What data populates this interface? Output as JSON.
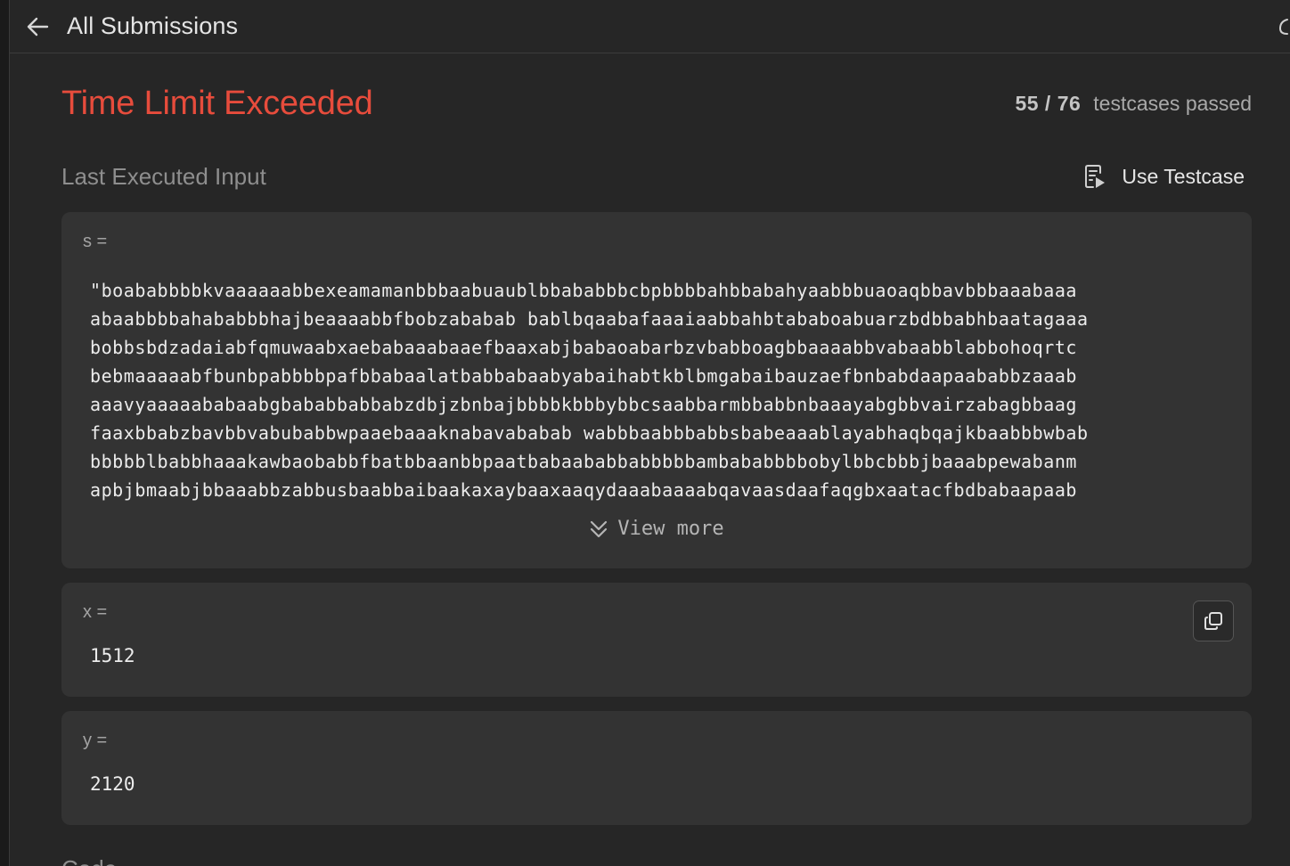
{
  "header": {
    "back_label": "All Submissions"
  },
  "result": {
    "status": "Time Limit Exceeded",
    "passed": "55 / 76",
    "passed_suffix": "testcases passed"
  },
  "last_input": {
    "label": "Last Executed Input",
    "use_testcase_label": "Use Testcase"
  },
  "inputs": {
    "s": {
      "label": "s =",
      "lines": [
        "\"boababbbbkvaaaaaabbexeamamanbbbaabuaublbbababbbcbpbbbbahbbabahyaabbbuaoaqbbavbbbaaabaaa",
        "abaabbbbahababbbhajbeaaaabbfbobzababab bablbqaabafaaaiaabbahbtababoabuarzbdbbabhbaatagaaa",
        "bobbsbdzadaiabfqmuwaabxaebabaaabaaefbaaxabjbabaoabarbzvbabboagbbaaaabbvabaabblabbohoqrtc",
        "bebmaaaaabfbunbpabbbbpafbbabaalatbabbabaabyabaihabtkblbmgabaibauzaefbnbabdaapaababbzaaab",
        "aaavyaaaaababaabgbababbabbabzdbjzbnbajbbbbkbbbybbcsaabbarmbbabbnbaaayabgbbvairzabagbbaag",
        "faaxbbabzbavbbvabubabbwpaaebaaaknabavababab wabbbaabbbabbsbabeaaablayabhaqbqajkbaabbbwbab",
        "bbbbblbabbhaaakawbaobabbfbatbbaanbbpaatbabaababbabbbbbambababbbbobylbbcbbbjbaaabpewabanm",
        "apbjbmaabjbbaaabbzabbusbaabbaibaakaxaybaaxaaqydaaabaaaabqavaasdaafaqgbxaatacfbdbabaapaab"
      ],
      "view_more_label": "View more"
    },
    "x": {
      "label": "x =",
      "value": "1512"
    },
    "y": {
      "label": "y =",
      "value": "2120"
    }
  },
  "next_section": {
    "label": "Code"
  }
}
